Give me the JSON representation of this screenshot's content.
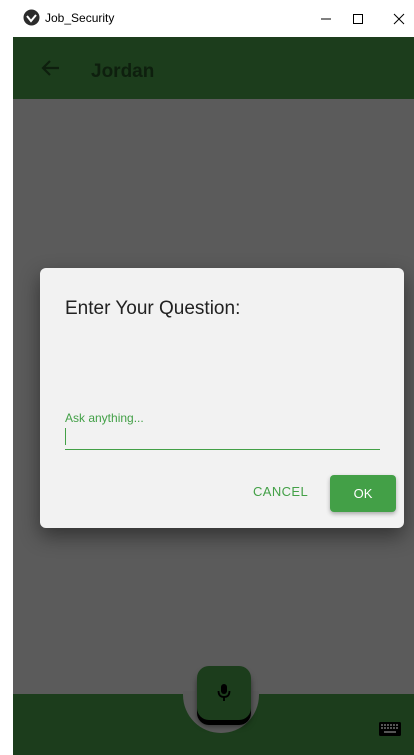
{
  "window": {
    "title": "Job_Security",
    "controls": [
      "minimize-icon",
      "maximize-icon",
      "close-icon"
    ]
  },
  "appbar": {
    "back_icon": "arrow-left-icon",
    "title": "Jordan"
  },
  "dialog": {
    "title": "Enter Your Question:",
    "input_label": "Ask anything...",
    "input_value": "",
    "cancel_label": "CANCEL",
    "ok_label": "OK"
  },
  "bottombar": {
    "mic_icon": "microphone-icon",
    "keyboard_icon": "keyboard-icon"
  },
  "colors": {
    "primary_dark": "#1c3d1c",
    "accent": "#43a047",
    "overlay": "#5b5b5b",
    "dialog_bg": "#f2f2f2"
  }
}
